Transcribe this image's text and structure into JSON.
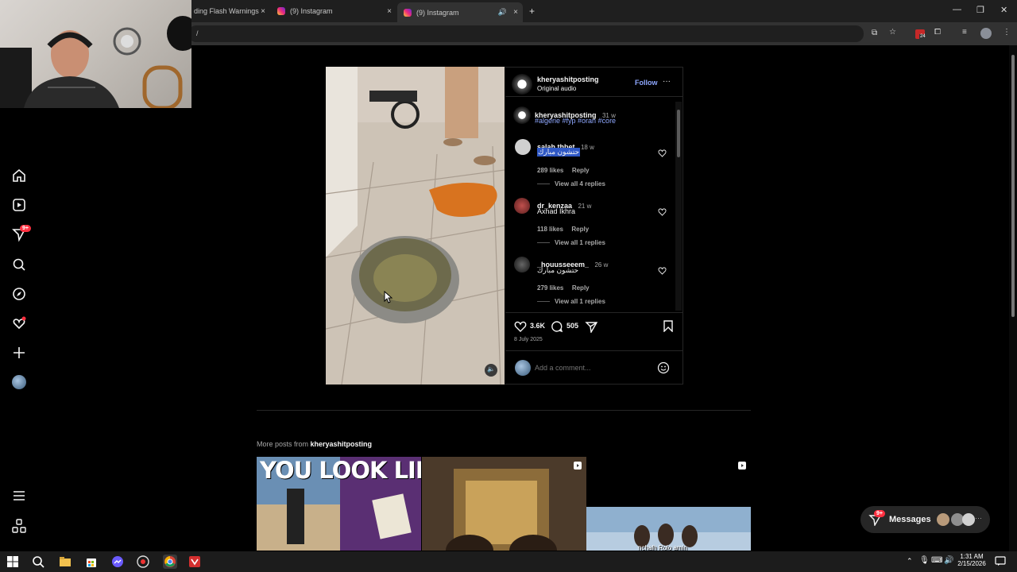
{
  "browser": {
    "tabs": [
      {
        "title": "ding Flash Warnings",
        "close": "×"
      },
      {
        "title": "(9) Instagram",
        "close": "×"
      },
      {
        "title": "(9) Instagram",
        "close": "×"
      }
    ],
    "new_tab": "+",
    "url_fragment": "/",
    "extension_badge": "24"
  },
  "nav": {
    "notifications_badge": "9+"
  },
  "post": {
    "author": "kheryashitposting",
    "audio": "Original audio",
    "follow_label": "Follow",
    "more_label": "···",
    "caption": {
      "user": "kheryashitposting",
      "time": "31 w",
      "tags": "#algerie #fyp #oran #core"
    },
    "comments": [
      {
        "user": "salah.thbet",
        "time": "18 w",
        "text": "حتشون مبارك",
        "likes": "289 likes",
        "reply": "Reply",
        "view_replies": "View all 4 replies"
      },
      {
        "user": "dr_kenzaa",
        "time": "21 w",
        "text": "Axhad Ikhra",
        "likes": "118 likes",
        "reply": "Reply",
        "view_replies": "View all 1 replies"
      },
      {
        "user": "_houusseeem_",
        "time": "26 w",
        "text": "حتشون مبارك",
        "likes": "279 likes",
        "reply": "Reply",
        "view_replies": "View all 1 replies"
      }
    ],
    "like_count": "3.6K",
    "comment_count": "505",
    "date": "8 July 2025",
    "add_comment_placeholder": "Add a comment..."
  },
  "more_posts": {
    "prefix": "More posts from ",
    "user": "kheryashitposting",
    "thumb1_text": "YOU LOOK LIKE TH",
    "thumb3_text": "nchalh Rolo amin"
  },
  "messages": {
    "label": "Messages",
    "badge": "9+"
  },
  "taskbar": {
    "time": "1:31 AM",
    "date": "2/15/2026"
  },
  "colors": {
    "accent_link": "#8fa8ff",
    "badge_red": "#ff3040",
    "follow_blue": "#8fa8ff"
  }
}
